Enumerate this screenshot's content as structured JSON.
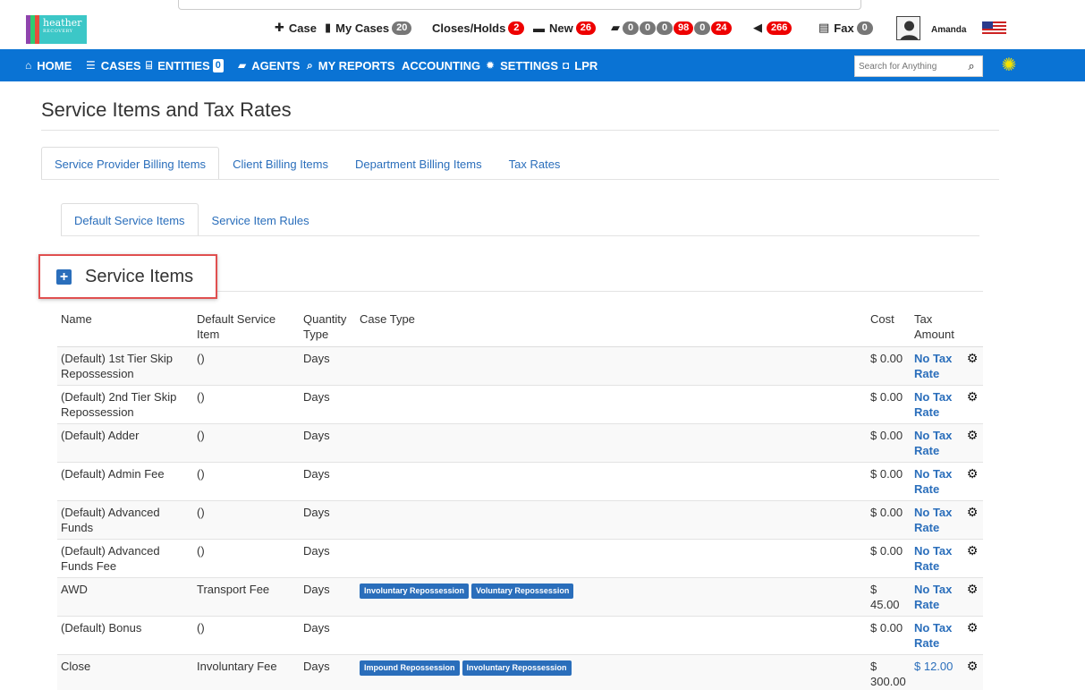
{
  "logo": {
    "line1": "heather",
    "line2": "RECOVERY"
  },
  "topbar": {
    "case": "Case",
    "my_cases": "My Cases",
    "my_cases_count": "20",
    "closes_holds": "Closes/Holds",
    "closes_holds_count": "2",
    "new": "New",
    "new_count": "26",
    "truck_counts": [
      "0",
      "0",
      "0",
      "98",
      "0",
      "24"
    ],
    "announce_count": "266",
    "fax": "Fax",
    "fax_count": "0",
    "user": "Amanda"
  },
  "nav": {
    "home": "HOME",
    "cases": "CASES",
    "entities": "ENTITIES",
    "entities_count": "0",
    "agents": "AGENTS",
    "reports": "MY REPORTS",
    "accounting": "ACCOUNTING",
    "settings": "SETTINGS",
    "lpr": "LPR",
    "search_placeholder": "Search for Anything"
  },
  "page": {
    "title": "Service Items and Tax Rates"
  },
  "tabs": [
    "Service Provider Billing Items",
    "Client Billing Items",
    "Department Billing Items",
    "Tax Rates"
  ],
  "subtabs": [
    "Default Service Items",
    "Service Item Rules"
  ],
  "section": {
    "title": "Service Items"
  },
  "table": {
    "headers": [
      "Name",
      "Default Service Item",
      "Quantity Type",
      "Case Type",
      "Cost",
      "Tax Amount"
    ],
    "rows": [
      {
        "name": "(Default) 1st Tier Skip Repossession",
        "default": "()",
        "qty": "Days",
        "case_types": [],
        "cost": "$ 0.00",
        "tax": "No Tax Rate"
      },
      {
        "name": "(Default) 2nd Tier Skip Repossession",
        "default": "()",
        "qty": "Days",
        "case_types": [],
        "cost": "$ 0.00",
        "tax": "No Tax Rate"
      },
      {
        "name": "(Default) Adder",
        "default": "()",
        "qty": "Days",
        "case_types": [],
        "cost": "$ 0.00",
        "tax": "No Tax Rate"
      },
      {
        "name": "(Default) Admin Fee",
        "default": "()",
        "qty": "Days",
        "case_types": [],
        "cost": "$ 0.00",
        "tax": "No Tax Rate"
      },
      {
        "name": "(Default) Advanced Funds",
        "default": "()",
        "qty": "Days",
        "case_types": [],
        "cost": "$ 0.00",
        "tax": "No Tax Rate"
      },
      {
        "name": "(Default) Advanced Funds Fee",
        "default": "()",
        "qty": "Days",
        "case_types": [],
        "cost": "$ 0.00",
        "tax": "No Tax Rate"
      },
      {
        "name": "AWD",
        "default": "Transport Fee",
        "qty": "Days",
        "case_types": [
          "Involuntary Repossession",
          "Voluntary Repossession"
        ],
        "cost": "$ 45.00",
        "tax": "No Tax Rate"
      },
      {
        "name": "(Default) Bonus",
        "default": "()",
        "qty": "Days",
        "case_types": [],
        "cost": "$ 0.00",
        "tax": "No Tax Rate"
      },
      {
        "name": "Close",
        "default": "Involuntary Fee",
        "qty": "Days",
        "case_types": [
          "Impound Repossession",
          "Involuntary Repossession"
        ],
        "cost": "$ 300.00",
        "tax": "$ 12.00",
        "tax_plain": true
      }
    ]
  }
}
